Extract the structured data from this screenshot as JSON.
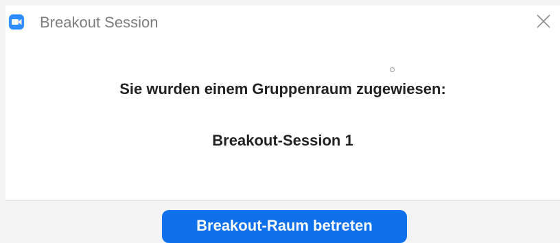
{
  "window": {
    "title": "Breakout Session",
    "app_icon": "zoom-camera-icon",
    "close_icon": "close-icon"
  },
  "dialog": {
    "message": "Sie wurden einem Gruppenraum zugewiesen:",
    "room_name": "Breakout-Session 1"
  },
  "footer": {
    "join_button_label": "Breakout-Raum betreten"
  },
  "colors": {
    "accent": "#0e71eb",
    "icon": "#2d8cff",
    "title_text": "#7d7d7d"
  }
}
